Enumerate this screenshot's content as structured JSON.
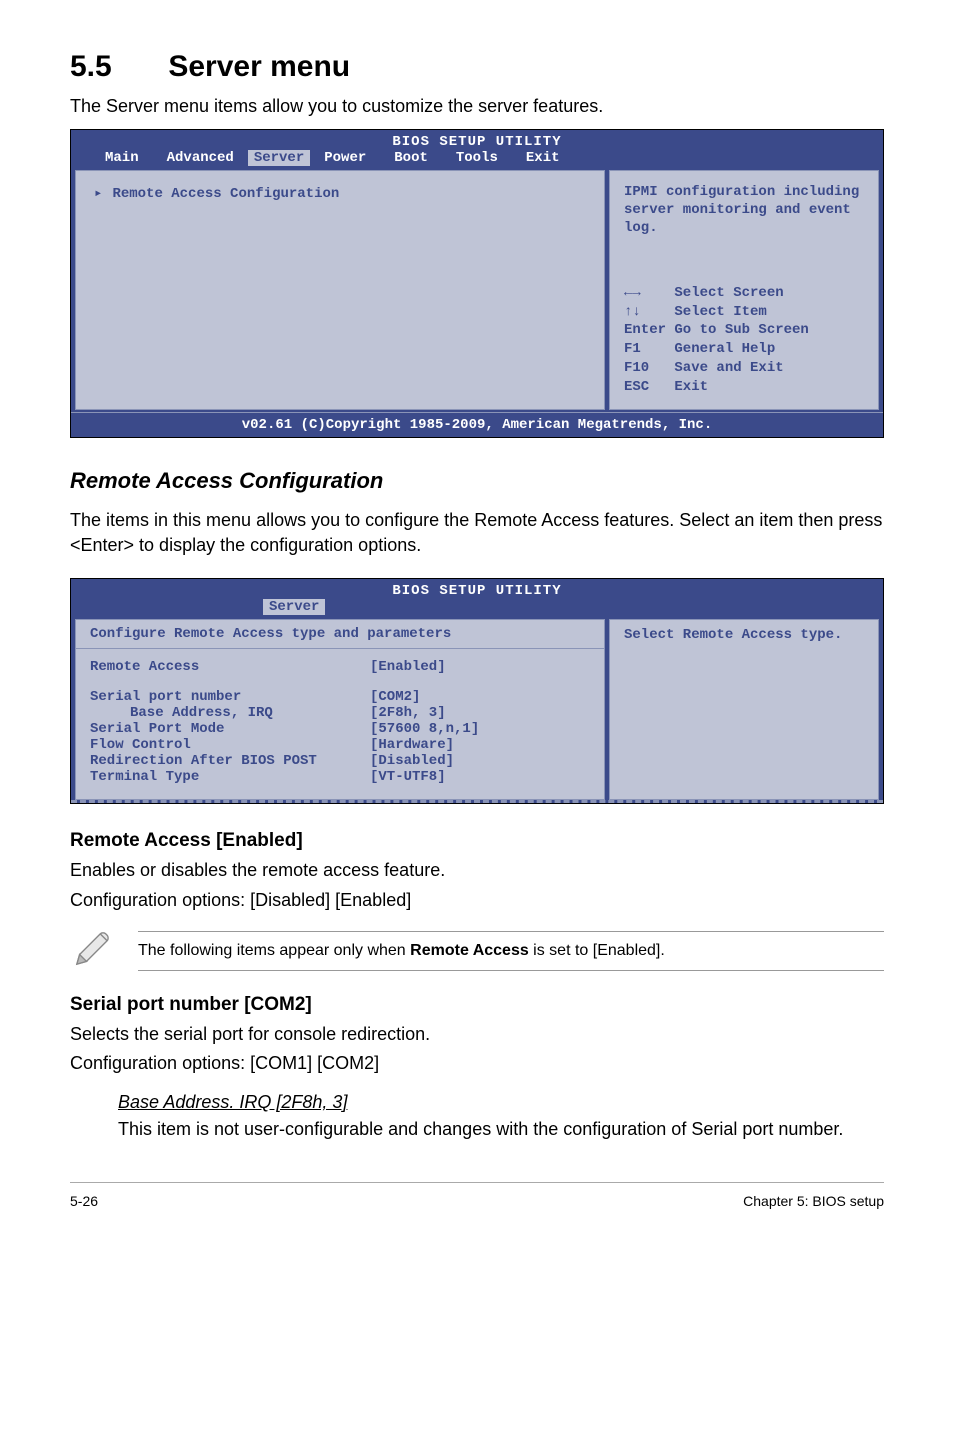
{
  "section": {
    "number": "5.5",
    "title": "Server menu"
  },
  "intro": "The Server menu items allow you to customize the server features.",
  "bios1": {
    "header": "BIOS SETUP UTILITY",
    "tabs": [
      "Main",
      "Advanced",
      "Server",
      "Power",
      "Boot",
      "Tools",
      "Exit"
    ],
    "active_tab": "Server",
    "left_item": "Remote Access Configuration",
    "help_top": "IPMI configuration including server monitoring and event log.",
    "help_bottom": "←→    Select Screen\n↑↓    Select Item\nEnter Go to Sub Screen\nF1    General Help\nF10   Save and Exit\nESC   Exit",
    "footer": "v02.61 (C)Copyright 1985-2009, American Megatrends, Inc."
  },
  "remote_heading": "Remote Access Configuration",
  "remote_text": "The items in this menu allows you to configure the Remote Access features. Select an item then press <Enter> to display the configuration options.",
  "bios2": {
    "header": "BIOS SETUP UTILITY",
    "tab": "Server",
    "top_line": "Configure Remote Access type and parameters",
    "rows": [
      {
        "label": "Remote Access",
        "value": "[Enabled]",
        "blank_after": true
      },
      {
        "label": "Serial port number",
        "value": "[COM2]"
      },
      {
        "label": "Base Address, IRQ",
        "value": "[2F8h, 3]",
        "indent": true
      },
      {
        "label": "Serial Port Mode",
        "value": "[57600 8,n,1]"
      },
      {
        "label": "Flow Control",
        "value": "[Hardware]"
      },
      {
        "label": "Redirection After BIOS POST",
        "value": "[Disabled]"
      },
      {
        "label": "Terminal Type",
        "value": "[VT-UTF8]"
      }
    ],
    "help": "Select Remote Access type."
  },
  "opt_remote": {
    "heading": "Remote Access [Enabled]",
    "line1": "Enables or disables the remote access feature.",
    "line2": "Configuration options: [Disabled] [Enabled]"
  },
  "note": {
    "text_prefix": "The following items appear only when ",
    "text_bold": "Remote Access",
    "text_suffix": " is set to [Enabled]."
  },
  "opt_serial": {
    "heading": "Serial port number [COM2]",
    "line1": "Selects the serial port for console redirection.",
    "line2": "Configuration options: [COM1] [COM2]"
  },
  "base_addr": {
    "title": "Base Address. IRQ [2F8h, 3]",
    "text": "This item is not user-configurable and changes with the configuration of Serial port number."
  },
  "footer": {
    "left": "5-26",
    "right": "Chapter 5: BIOS setup"
  }
}
